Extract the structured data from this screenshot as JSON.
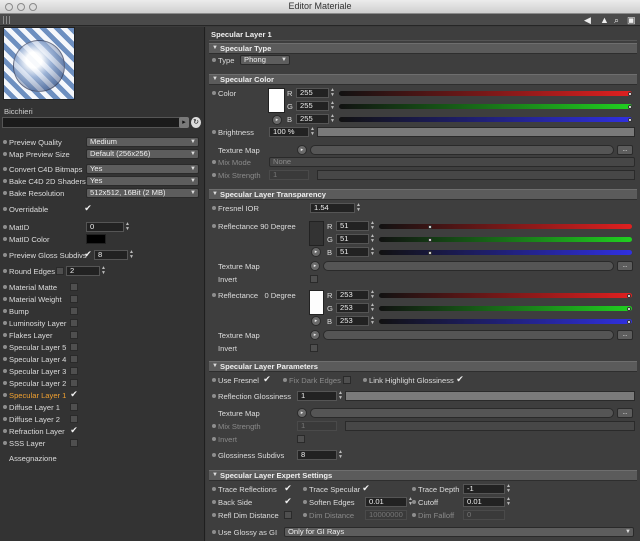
{
  "window": {
    "title": "Editor Materiale"
  },
  "material": {
    "name": "Bicchieri",
    "name_value": ""
  },
  "left": {
    "preview_quality": {
      "label": "Preview Quality",
      "value": "Medium"
    },
    "map_preview_size": {
      "label": "Map Preview Size",
      "value": "Default (256x256)"
    },
    "convert_c4d": {
      "label": "Convert C4D Bitmaps",
      "value": "Yes"
    },
    "bake_c4d": {
      "label": "Bake C4D 2D Shaders",
      "value": "Yes"
    },
    "bake_resolution": {
      "label": "Bake Resolution",
      "value": "512x512, 16Bit (2 MB)"
    },
    "overridable": {
      "label": "Overridable",
      "checked": "✔"
    },
    "mat_id": {
      "label": "MatID",
      "value": "0"
    },
    "mat_id_color": {
      "label": "MatID Color",
      "color": "#000000"
    },
    "preview_gloss": {
      "label": "Preview Gloss Subdivs",
      "checked": "✔",
      "value": "8"
    },
    "round_edges": {
      "label": "Round Edges",
      "value": "2"
    },
    "layers": [
      {
        "label": "Material Matte",
        "checked": ""
      },
      {
        "label": "Material Weight",
        "checked": ""
      },
      {
        "label": "Bump",
        "checked": ""
      },
      {
        "label": "Luminosity Layer",
        "checked": ""
      },
      {
        "label": "Flakes Layer",
        "checked": ""
      },
      {
        "label": "Specular Layer 5",
        "checked": ""
      },
      {
        "label": "Specular Layer 4",
        "checked": ""
      },
      {
        "label": "Specular Layer 3",
        "checked": ""
      },
      {
        "label": "Specular Layer 2",
        "checked": ""
      },
      {
        "label": "Specular Layer 1",
        "checked": "✔"
      },
      {
        "label": "Diffuse Layer 1",
        "checked": ""
      },
      {
        "label": "Diffuse Layer 2",
        "checked": ""
      },
      {
        "label": "Refraction Layer",
        "checked": "✔"
      },
      {
        "label": "SSS Layer",
        "checked": ""
      }
    ],
    "assignment": "Assegnazione"
  },
  "right": {
    "title": "Specular Layer 1",
    "specular_type": {
      "header": "Specular Type",
      "type_label": "Type",
      "type_value": "Phong"
    },
    "specular_color": {
      "header": "Specular Color",
      "color_label": "Color",
      "swatch": "#ffffff",
      "r": {
        "label": "R",
        "value": "255"
      },
      "g": {
        "label": "G",
        "value": "255"
      },
      "b": {
        "label": "B",
        "value": "255"
      },
      "brightness_label": "Brightness",
      "brightness_value": "100 %",
      "texture_map": "Texture Map",
      "mix_mode": "Mix Mode",
      "mix_mode_value": "None",
      "mix_strength": "Mix Strength",
      "mix_strength_value": "1",
      "more": "..."
    },
    "transparency": {
      "header": "Specular Layer Transparency",
      "fresnel_label": "Fresnel IOR",
      "fresnel_value": "1.54",
      "refl90_label": "Reflectance 90 Degree",
      "refl90_swatch": "#333333",
      "r90": {
        "label": "R",
        "value": "51"
      },
      "g90": {
        "label": "G",
        "value": "51"
      },
      "b90": {
        "label": "B",
        "value": "51"
      },
      "texture_map": "Texture Map",
      "invert": "Invert",
      "refl0_label": "Reflectance",
      "refl0_deg": "0 Degree",
      "refl0_swatch": "#fdfdfd",
      "r0": {
        "label": "R",
        "value": "253"
      },
      "g0": {
        "label": "G",
        "value": "253"
      },
      "b0": {
        "label": "B",
        "value": "253"
      },
      "texture_map2": "Texture Map",
      "invert2": "Invert",
      "more": "..."
    },
    "parameters": {
      "header": "Specular Layer Parameters",
      "use_fresnel": "Use Fresnel",
      "use_fresnel_checked": "✔",
      "fix_dark_edges": "Fix Dark Edges",
      "link_highlight": "Link Highlight Glossiness",
      "link_highlight_checked": "✔",
      "refl_gloss_label": "Reflection Glossiness",
      "refl_gloss_value": "1",
      "texture_map": "Texture Map",
      "mix_strength": "Mix Strength",
      "mix_strength_value": "1",
      "invert": "Invert",
      "gloss_subdivs_label": "Glossiness Subdivs",
      "gloss_subdivs_value": "8",
      "more": "..."
    },
    "expert": {
      "header": "Specular Layer Expert Settings",
      "trace_reflections": "Trace Reflections",
      "trace_reflections_checked": "✔",
      "trace_specular": "Trace Specular",
      "trace_specular_checked": "✔",
      "trace_depth": "Trace Depth",
      "trace_depth_value": "-1",
      "back_side": "Back Side",
      "back_side_checked": "✔",
      "soften_edges": "Soften Edges",
      "soften_edges_value": "0.01",
      "cutoff": "Cutoff",
      "cutoff_value": "0.01",
      "refl_dim": "Refl Dim Distance",
      "dim_distance": "Dim Distance",
      "dim_distance_value": "10000000",
      "dim_falloff": "Dim Falloff",
      "dim_falloff_value": "0",
      "use_glossy_gi": "Use Glossy as GI",
      "use_glossy_gi_value": "Only for GI Rays"
    }
  },
  "colors": {
    "accent": "#f0a030",
    "red": "#e02020",
    "green": "#20d020",
    "blue": "#3030e0"
  }
}
